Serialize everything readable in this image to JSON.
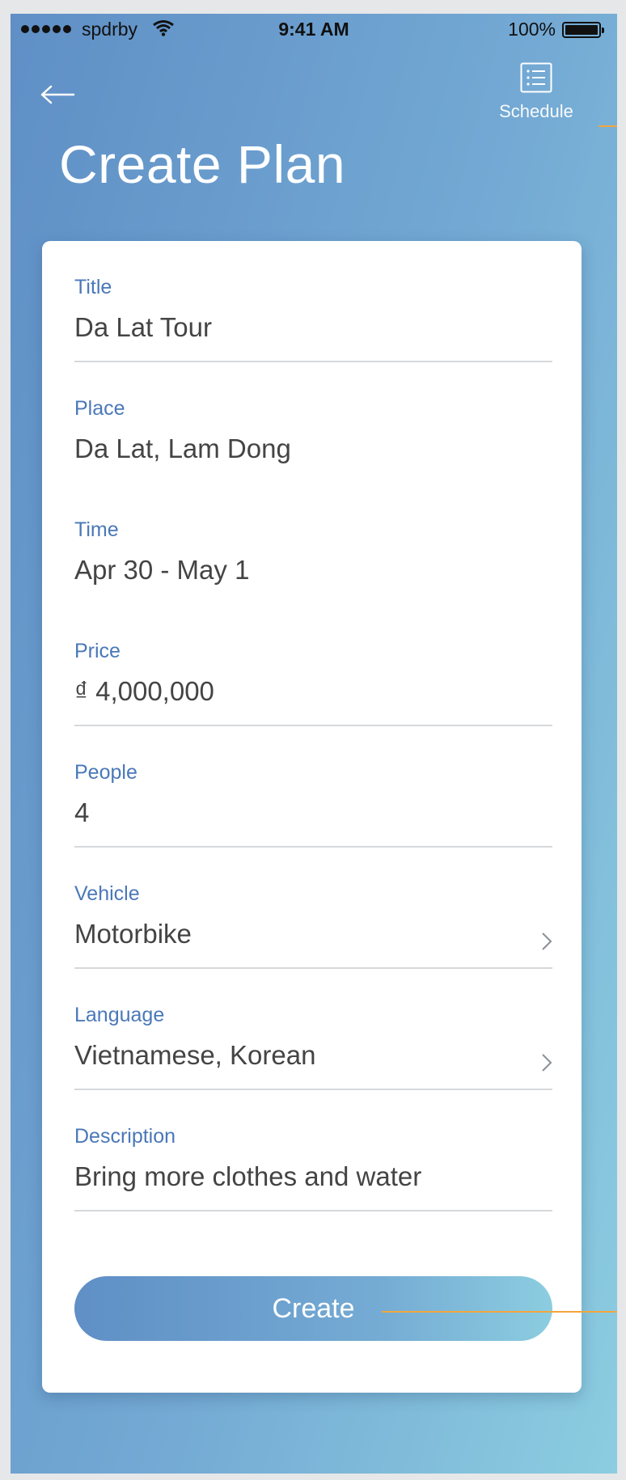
{
  "status": {
    "carrier": "spdrby",
    "time": "9:41 AM",
    "battery": "100%"
  },
  "header": {
    "title": "Create Plan",
    "schedule_label": "Schedule"
  },
  "fields": [
    {
      "label": "Title",
      "value": "Da Lat Tour"
    },
    {
      "label": "Place",
      "value": "Da Lat, Lam Dong"
    },
    {
      "label": "Time",
      "value": "Apr 30 - May 1"
    },
    {
      "label": "Price",
      "value": "₫ 4,000,000"
    },
    {
      "label": "People",
      "value": "4"
    },
    {
      "label": "Vehicle",
      "value": "Motorbike"
    },
    {
      "label": "Language",
      "value": "Vietnamese, Korean"
    },
    {
      "label": "Description",
      "value": "Bring more clothes and water"
    }
  ],
  "actions": {
    "create_label": "Create"
  },
  "icons": {
    "back": "arrow-left-icon",
    "schedule": "list-icon",
    "chevron": "chevron-right-icon"
  },
  "colors": {
    "accent": "#4a78b8",
    "gradient_start": "#5f8fc6",
    "gradient_end": "#8ccde0",
    "annotation": "#f3a63c"
  }
}
